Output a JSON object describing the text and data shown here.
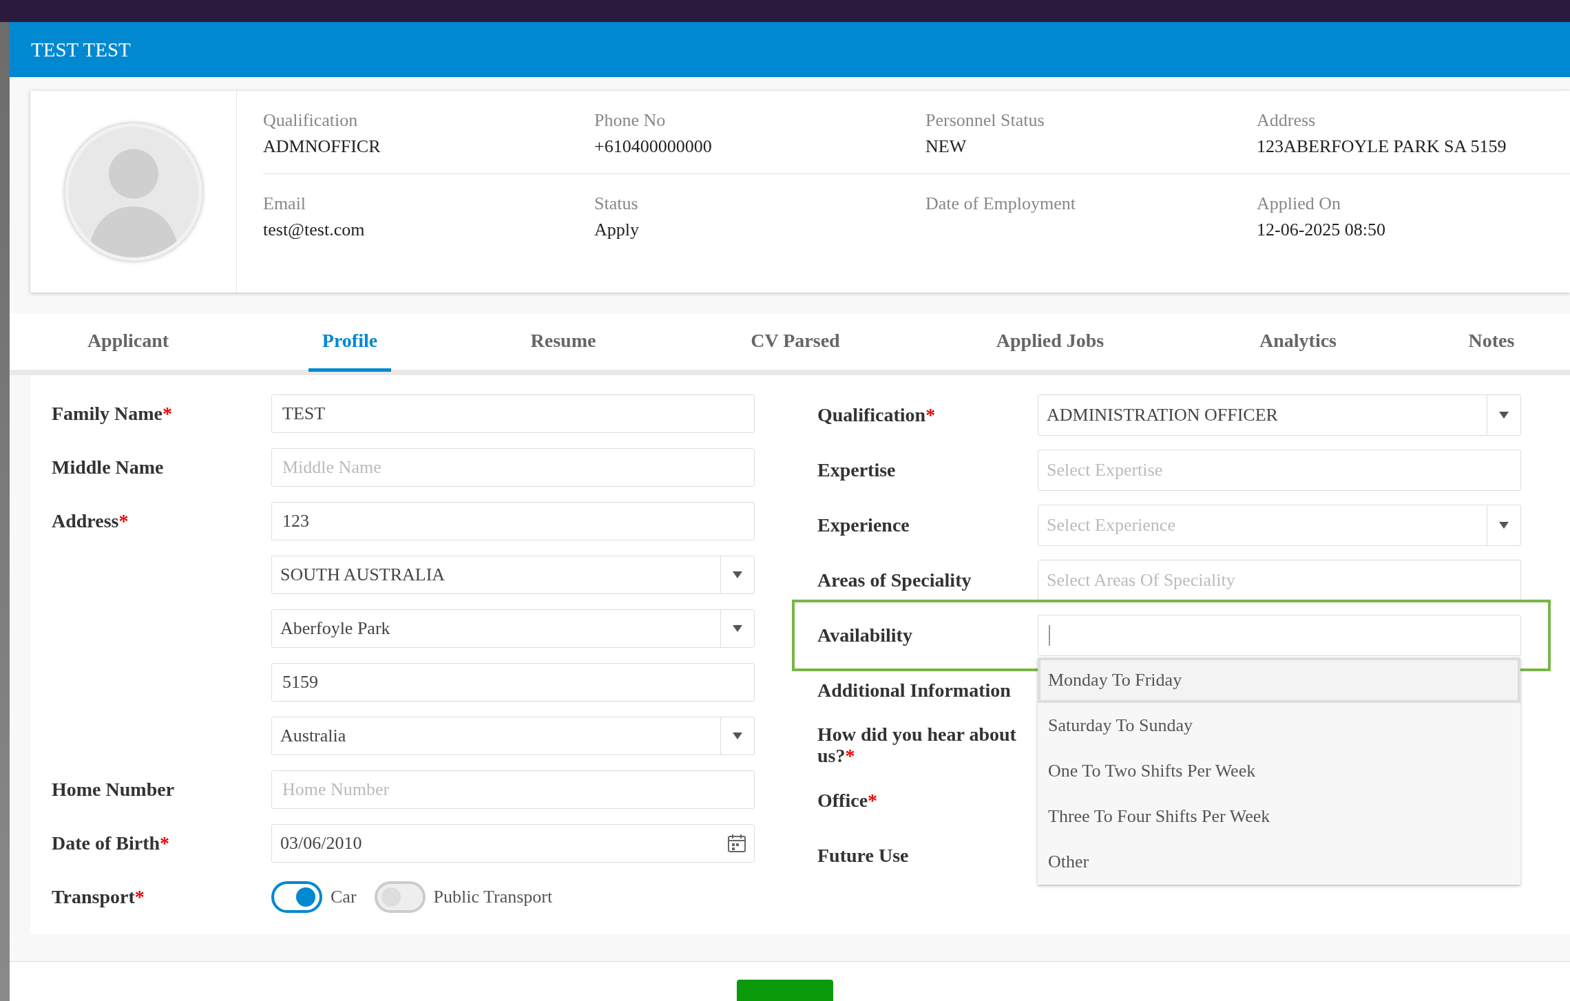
{
  "window": {
    "title": "TEST TEST"
  },
  "profile": {
    "fields": [
      {
        "label": "Qualification",
        "value": "ADMNOFFICR"
      },
      {
        "label": "Phone No",
        "value": "+610400000000"
      },
      {
        "label": "Personnel Status",
        "value": "NEW"
      },
      {
        "label": "Address",
        "value": "123ABERFOYLE PARK SA 5159"
      },
      {
        "label": "Email",
        "value": "test@test.com"
      },
      {
        "label": "Status",
        "value": "Apply"
      },
      {
        "label": "Date of Employment"
      },
      {
        "label": "Applied On",
        "value": "12-06-2025 08:50"
      }
    ]
  },
  "tabs": [
    {
      "label": "Applicant",
      "selected": false
    },
    {
      "label": "Profile",
      "selected": true
    },
    {
      "label": "Resume",
      "selected": false
    },
    {
      "label": "CV Parsed",
      "selected": false
    },
    {
      "label": "Applied Jobs",
      "selected": false
    },
    {
      "label": "Analytics",
      "selected": false
    },
    {
      "label": "Notes",
      "selected": false
    }
  ],
  "left_form": [
    {
      "label": "Family Name",
      "mark": "*",
      "kind": "text",
      "value": "TEST"
    },
    {
      "label": "Middle Name",
      "kind": "text",
      "placeholder": "Middle Name"
    },
    {
      "label": "Address",
      "mark": "*",
      "kind": "text",
      "value": "123"
    },
    {
      "kind": "select",
      "value": "SOUTH AUSTRALIA"
    },
    {
      "kind": "select",
      "value": "Aberfoyle Park"
    },
    {
      "kind": "text",
      "value": "5159"
    },
    {
      "kind": "select",
      "value": "Australia"
    },
    {
      "label": "Home Number",
      "kind": "text",
      "placeholder": "Home Number"
    },
    {
      "label": "Date of Birth",
      "mark": "*",
      "kind": "date",
      "value": "03/06/2010"
    },
    {
      "label": "Transport",
      "mark": "*",
      "kind": "toggles",
      "options": [
        {
          "label": "Car",
          "on": true
        },
        {
          "label": "Public Transport",
          "on": false
        }
      ]
    }
  ],
  "right_form": [
    {
      "label": "Qualification",
      "mark": "*",
      "kind": "select",
      "value": "ADMINISTRATION OFFICER"
    },
    {
      "label": "Expertise",
      "kind": "multi",
      "placeholder": "Select Expertise"
    },
    {
      "label": "Experience",
      "kind": "select",
      "placeholder": "Select Experience"
    },
    {
      "label": "Areas of Speciality",
      "kind": "multi",
      "placeholder": "Select Areas Of Speciality"
    },
    {
      "label": "Availability",
      "kind": "search",
      "focused": true,
      "options": [
        {
          "label": "Monday To Friday",
          "selected": true
        },
        {
          "label": "Saturday To Sunday",
          "selected": false
        },
        {
          "label": "One To Two Shifts Per Week",
          "selected": false
        },
        {
          "label": "Three To Four Shifts Per Week",
          "selected": false
        },
        {
          "label": "Other",
          "selected": false
        }
      ]
    },
    {
      "label": "Additional Information",
      "kind": "covered"
    },
    {
      "label": "How did you hear about us?",
      "mark": "*",
      "kind": "covered"
    },
    {
      "label": "Office",
      "mark": "*",
      "kind": "covered"
    },
    {
      "label": "Future Use",
      "kind": "covered"
    }
  ]
}
